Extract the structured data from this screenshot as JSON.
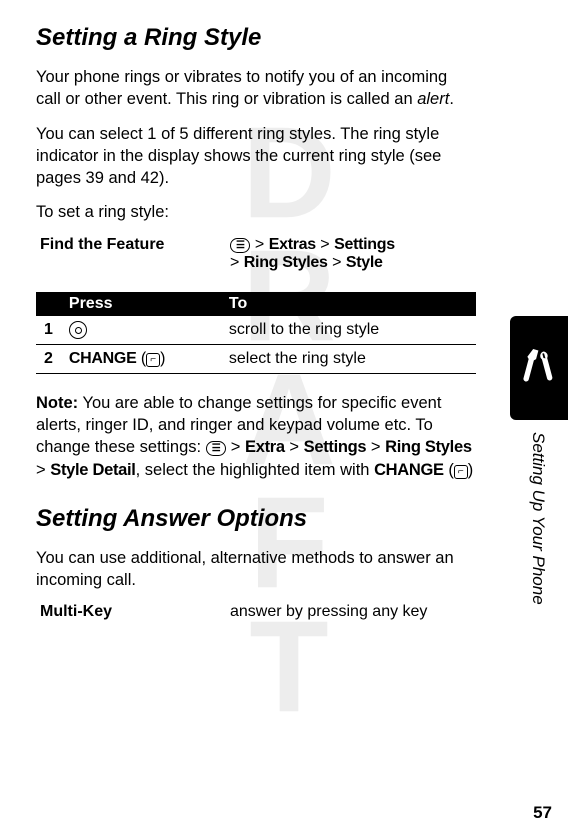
{
  "watermark": "DRAFT",
  "h1a": "Setting a Ring Style",
  "p1": "Your phone rings or vibrates to notify you of an incoming call or other event. This ring or vibration is called an ",
  "p1_em": "alert",
  "p1_end": ".",
  "p2": "You can select 1 of 5 different ring styles. The ring style indicator in the display shows the current ring style (see pages 39 and 42).",
  "p3": "To set a ring style:",
  "find_feature_label": "Find the Feature",
  "path": {
    "sep": ">",
    "extras": "Extras",
    "settings": "Settings",
    "ring_styles": "Ring Styles",
    "style": "Style"
  },
  "table": {
    "h_press": "Press",
    "h_to": "To",
    "r1_num": "1",
    "r1_to": "scroll to the ring style",
    "r2_num": "2",
    "r2_press": "CHANGE",
    "r2_to": "select the ring style"
  },
  "note": {
    "label": "Note:",
    "t1": " You are able to change settings for specific event alerts, ringer ID, and ringer and keypad volume etc. To change these settings: ",
    "extra": "Extra",
    "settings": "Settings",
    "ring_styles": "Ring Styles",
    "style_detail": "Style Detail",
    "t2": ", select the highlighted item with ",
    "change": "CHANGE"
  },
  "h1b": "Setting Answer Options",
  "p4": "You can use additional, alternative methods to answer an incoming call.",
  "multi_key": "Multi-Key",
  "multi_desc": "answer by pressing any key",
  "side_label": "Setting Up Your Phone",
  "page_number": "57"
}
